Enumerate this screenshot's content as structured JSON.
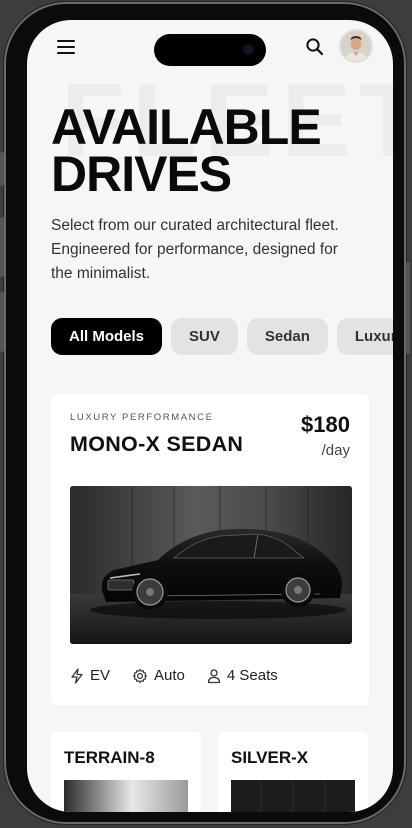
{
  "header": {
    "menu_icon": "hamburger-menu-icon",
    "search_icon": "search-icon",
    "avatar": "user-avatar"
  },
  "hero": {
    "watermark": "FLEET",
    "title_line1": "AVAILABLE",
    "title_line2": "DRIVES",
    "subtitle": "Select from our curated architectural fleet. Engineered for performance, designed for the minimalist."
  },
  "filters": [
    {
      "label": "All Models",
      "active": true
    },
    {
      "label": "SUV",
      "active": false
    },
    {
      "label": "Sedan",
      "active": false
    },
    {
      "label": "Luxury",
      "active": false
    }
  ],
  "featured": {
    "eyebrow": "LUXURY PERFORMANCE",
    "title": "MONO-X SEDAN",
    "price": "$180",
    "price_unit": "/day",
    "specs": [
      {
        "icon": "lightning-bolt-icon",
        "label": "EV"
      },
      {
        "icon": "gear-icon",
        "label": "Auto"
      },
      {
        "icon": "person-icon",
        "label": "4 Seats"
      }
    ]
  },
  "more_cars": [
    {
      "title": "TERRAIN-8"
    },
    {
      "title": "SILVER-X"
    }
  ],
  "colors": {
    "accent": "#000000",
    "chip_bg": "#e3e3e3",
    "screen_bg": "#f6f6f6"
  }
}
